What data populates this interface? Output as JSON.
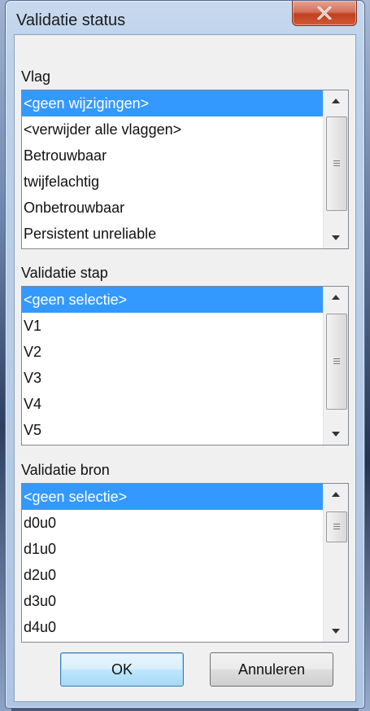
{
  "window": {
    "title": "Validatie status",
    "close_glyph": "x"
  },
  "groups": [
    {
      "label": "Vlag",
      "items": [
        "<geen wijzigingen>",
        "<verwijder alle vlaggen>",
        "Betrouwbaar",
        "twijfelachtig",
        "Onbetrouwbaar",
        "Persistent unreliable"
      ],
      "selected_index": 0
    },
    {
      "label": "Validatie stap",
      "items": [
        "<geen selectie>",
        "V1",
        "V2",
        "V3",
        "V4",
        "V5"
      ],
      "selected_index": 0
    },
    {
      "label": "Validatie bron",
      "items": [
        "<geen selectie>",
        "d0u0",
        "d1u0",
        "d2u0",
        "d3u0",
        "d4u0"
      ],
      "selected_index": 0
    }
  ],
  "buttons": {
    "ok": "OK",
    "cancel": "Annuleren"
  },
  "colors": {
    "selection": "#3399ff",
    "close_button": "#c7432a"
  }
}
